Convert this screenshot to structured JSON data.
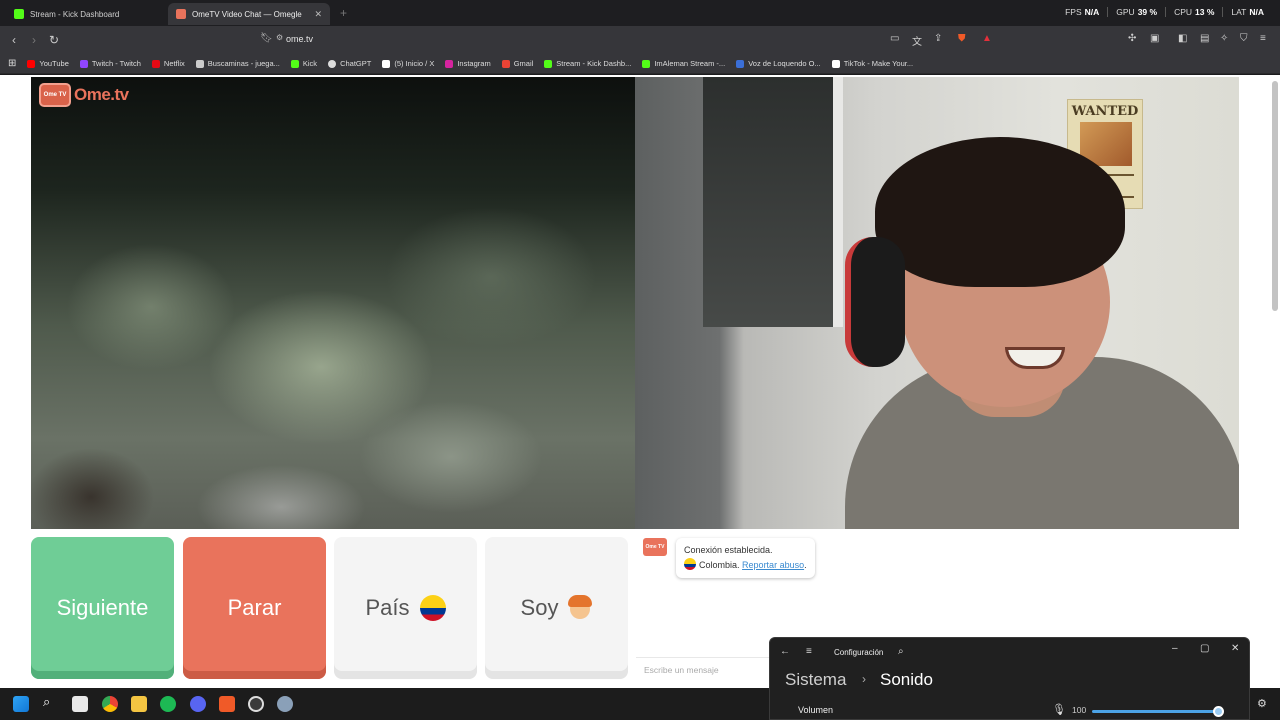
{
  "tabs": [
    {
      "title": "Stream - Kick Dashboard",
      "icon": "kick-icon",
      "color": "#53fc18"
    },
    {
      "title": "OmeTV Video Chat — Omegle",
      "icon": "ometv-icon",
      "color": "#e9735c"
    }
  ],
  "new_tab": "+",
  "stats": {
    "fps_label": "FPS",
    "fps_value": "N/A",
    "gpu_label": "GPU",
    "gpu_value": "39 %",
    "cpu_label": "CPU",
    "cpu_value": "13 %",
    "lat_label": "LAT",
    "lat_value": "N/A"
  },
  "address": {
    "url": "ome.tv"
  },
  "bookmarks": [
    {
      "label": "YouTube",
      "color": "#ff0000"
    },
    {
      "label": "Twitch - Twitch",
      "color": "#9146ff"
    },
    {
      "label": "Netflix",
      "color": "#e50914"
    },
    {
      "label": "Buscaminas - juega...",
      "color": "#cccccc"
    },
    {
      "label": "Kick",
      "color": "#53fc18"
    },
    {
      "label": "ChatGPT",
      "color": "#dddddd"
    },
    {
      "label": "(5) Inicio / X",
      "color": "#ffffff"
    },
    {
      "label": "Instagram",
      "color": "#d6249f"
    },
    {
      "label": "Gmail",
      "color": "#ea4335"
    },
    {
      "label": "Stream - Kick Dashb...",
      "color": "#53fc18"
    },
    {
      "label": "ImAleman Stream -...",
      "color": "#53fc18"
    },
    {
      "label": "Voz de Loquendo O...",
      "color": "#3b6fd8"
    },
    {
      "label": "TikTok - Make Your...",
      "color": "#ffffff"
    }
  ],
  "video": {
    "logo_badge": "Ome TV",
    "logo_text": "Ome.tv",
    "poster_text": "WANTED"
  },
  "controls": {
    "next": "Siguiente",
    "stop": "Parar",
    "country": "País",
    "gender": "Soy"
  },
  "chat": {
    "badge": "Ome TV",
    "connection": "Conexión establecida.",
    "country": "Colombia.",
    "report": "Reportar abuso",
    "report_end": ".",
    "placeholder": "Escribe un mensaje"
  },
  "settings": {
    "title": "Configuración",
    "crumb_parent": "Sistema",
    "crumb_sep": "›",
    "crumb_current": "Sonido",
    "volume_label": "Volumen",
    "volume_value": "100",
    "volume_level": 1.0
  }
}
